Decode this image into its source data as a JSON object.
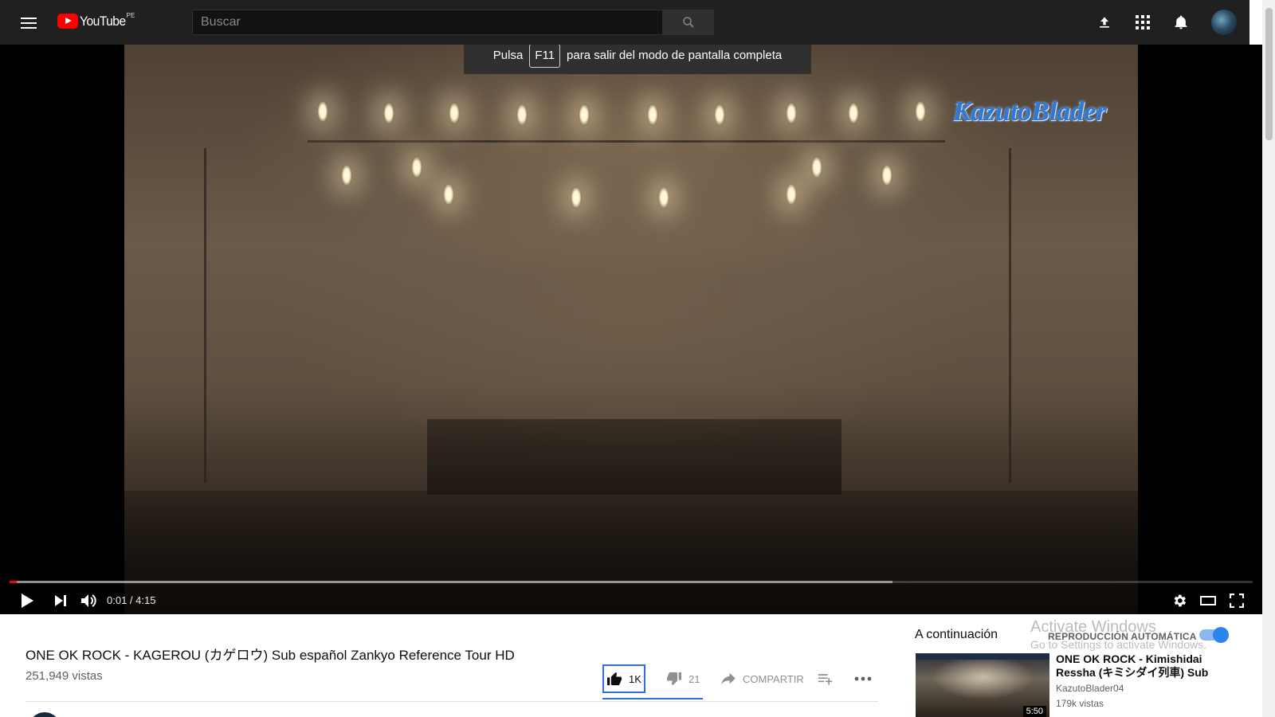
{
  "masthead": {
    "logo_text": "YouTube",
    "logo_country": "PE",
    "search_placeholder": "Buscar",
    "icons": [
      "menu-icon",
      "search-icon",
      "upload-icon",
      "apps-icon",
      "notifications-icon",
      "avatar"
    ]
  },
  "fullscreen_toast": {
    "prefix": "Pulsa",
    "key": "F11",
    "suffix": "para salir del modo de pantalla completa"
  },
  "player": {
    "watermark": "KazutoBlader",
    "current_time": "0:01 / 4:15",
    "played_fraction": 0.006,
    "buffered_fraction": 0.71,
    "progress_color": "#ff0000",
    "controls": [
      "play-icon",
      "next-icon",
      "volume-icon",
      "settings-icon",
      "theater-icon",
      "fullscreen-icon"
    ]
  },
  "video": {
    "title": "ONE OK ROCK - KAGEROU (カゲロウ) Sub español Zankyo Reference Tour HD",
    "views": "251,949 vistas",
    "likes": "1K",
    "dislikes": "21",
    "share_label": "COMPARTIR"
  },
  "sidebar": {
    "up_next_label": "A continuación",
    "autoplay_label": "REPRODUCCIÓN AUTOMÁTICA",
    "autoplay_on": true,
    "accent_color": "#2d84ea",
    "recommendation": {
      "title": "ONE OK ROCK - Kimishidai Ressha (キミシダイ列車) Sub",
      "channel": "KazutoBlader04",
      "views": "179k vistas",
      "duration": "5:50"
    }
  },
  "os_overlay": {
    "line1": "Activate Windows",
    "line2": "Go to Settings to activate Windows."
  }
}
